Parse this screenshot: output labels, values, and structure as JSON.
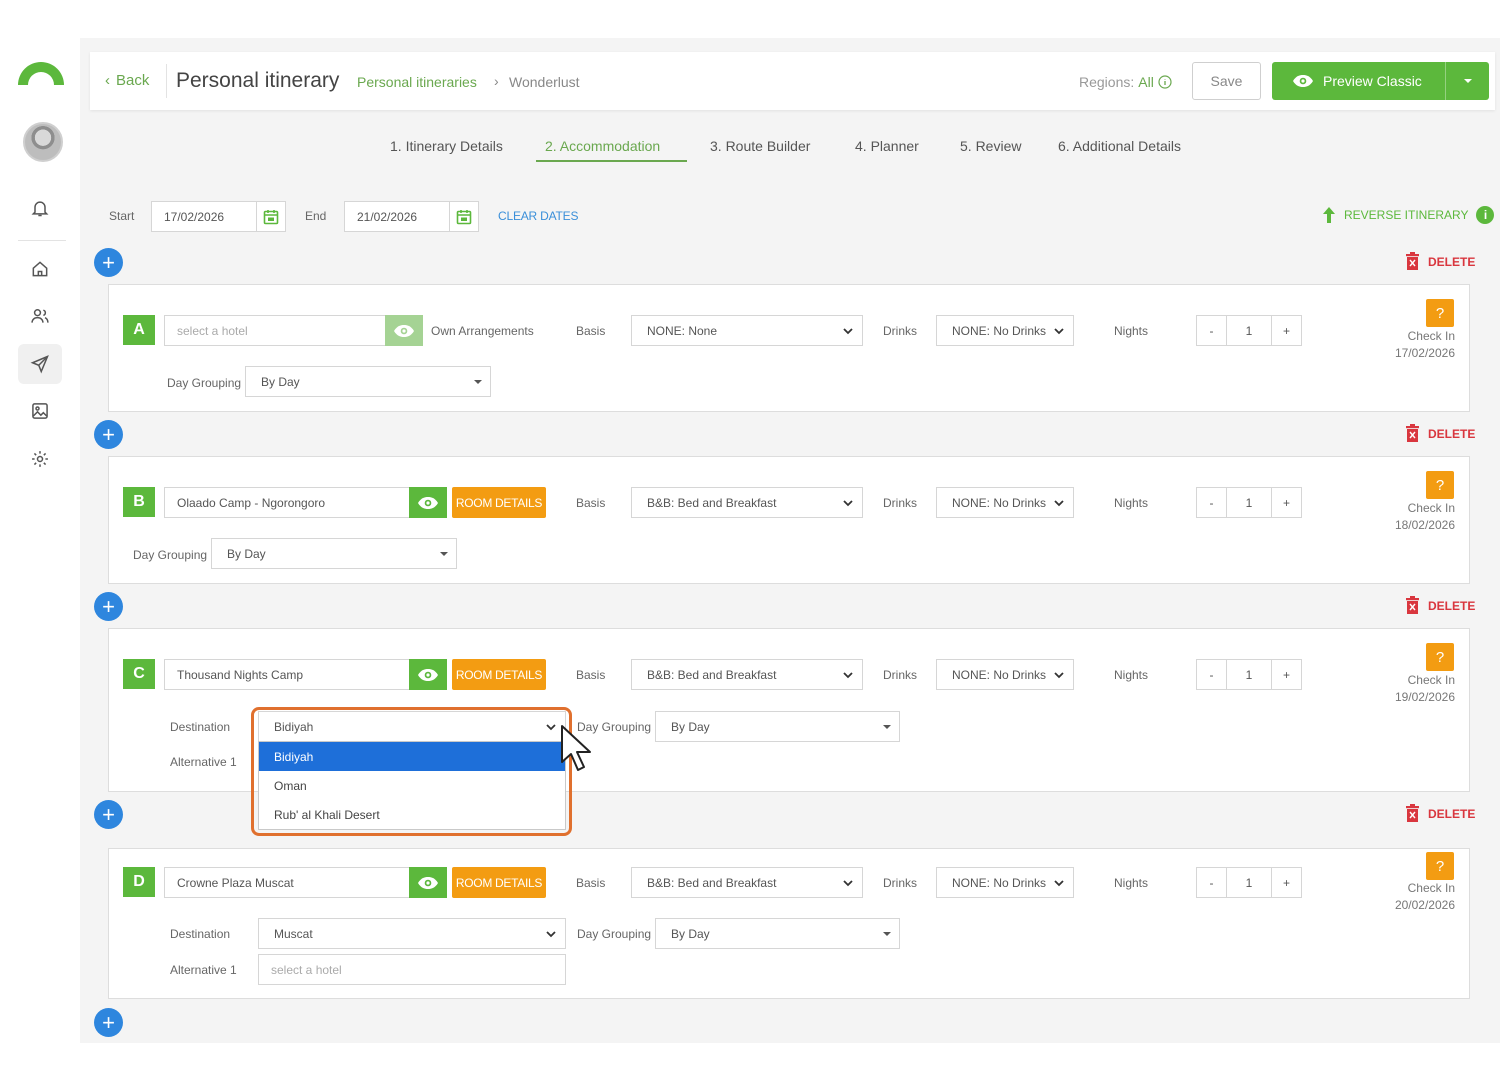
{
  "header": {
    "back_label": "Back",
    "title": "Personal itinerary",
    "breadcrumb_parent": "Personal itineraries",
    "breadcrumb_current": "Wonderlust",
    "regions_label": "Regions:",
    "regions_value": "All",
    "save_label": "Save",
    "preview_label": "Preview Classic"
  },
  "tabs": [
    {
      "label": "1. Itinerary Details"
    },
    {
      "label": "2. Accommodation"
    },
    {
      "label": "3. Route Builder"
    },
    {
      "label": "4. Planner"
    },
    {
      "label": "5. Review"
    },
    {
      "label": "6. Additional Details"
    }
  ],
  "dates": {
    "start_label": "Start",
    "start_value": "17/02/2026",
    "end_label": "End",
    "end_value": "21/02/2026",
    "clear_label": "CLEAR DATES",
    "reverse_label": "REVERSE ITINERARY"
  },
  "labels": {
    "delete": "DELETE",
    "basis": "Basis",
    "drinks": "Drinks",
    "nights": "Nights",
    "day_grouping": "Day Grouping",
    "destination": "Destination",
    "alternative": "Alternative 1",
    "room_details": "ROOM DETAILS",
    "own_arrangements": "Own Arrangements",
    "check_in": "Check In",
    "hotel_placeholder": "select a hotel",
    "question": "?",
    "minus": "-",
    "plus": "+"
  },
  "cards": [
    {
      "letter": "A",
      "hotel": "",
      "basis": "NONE: None",
      "drinks": "NONE: No Drinks",
      "nights": "1",
      "day_grouping": "By Day",
      "check_in_date": "17/02/2026"
    },
    {
      "letter": "B",
      "hotel": "Olaado Camp - Ngorongoro",
      "basis": "B&B: Bed and Breakfast",
      "drinks": "NONE: No Drinks",
      "nights": "1",
      "day_grouping": "By Day",
      "check_in_date": "18/02/2026"
    },
    {
      "letter": "C",
      "hotel": "Thousand Nights Camp",
      "basis": "B&B: Bed and Breakfast",
      "drinks": "NONE: No Drinks",
      "nights": "1",
      "destination": "Bidiyah",
      "day_grouping": "By Day",
      "check_in_date": "19/02/2026"
    },
    {
      "letter": "D",
      "hotel": "Crowne Plaza Muscat",
      "basis": "B&B: Bed and Breakfast",
      "drinks": "NONE: No Drinks",
      "nights": "1",
      "destination": "Muscat",
      "day_grouping": "By Day",
      "check_in_date": "20/02/2026"
    }
  ],
  "destination_dropdown": {
    "options": [
      "Bidiyah",
      "Oman",
      "Rub' al Khali Desert"
    ],
    "selected": "Bidiyah"
  },
  "colors": {
    "brand_green": "#5cb83c",
    "accent_blue": "#2e86de",
    "orange": "#f39c12",
    "delete_red": "#d9363e",
    "highlight": "#e0702e"
  },
  "icons": [
    "logo-arc",
    "avatar",
    "bell-icon",
    "home-icon",
    "users-icon",
    "send-icon",
    "image-icon",
    "gear-icon",
    "calendar-icon",
    "eye-icon",
    "trash-icon",
    "info-icon",
    "arrow-up-icon",
    "chevron-down-icon",
    "cursor-icon"
  ]
}
